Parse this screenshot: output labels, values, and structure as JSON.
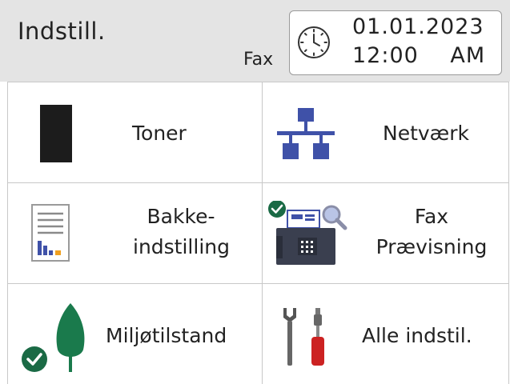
{
  "header": {
    "title": "Indstill.",
    "mode": "Fax",
    "date": "01.01.2023",
    "time": "12:00 AM"
  },
  "tiles": [
    {
      "label": "Toner",
      "icon": "toner-icon"
    },
    {
      "label": "Netværk",
      "icon": "network-icon"
    },
    {
      "label_line1": "Bakke-",
      "label_line2": "indstilling",
      "icon": "tray-settings-icon"
    },
    {
      "label_line1": "Fax",
      "label_line2": "Prævisning",
      "icon": "fax-preview-icon"
    },
    {
      "label": "Miljøtilstand",
      "icon": "eco-leaf-icon"
    },
    {
      "label": "Alle indstil.",
      "icon": "tools-icon"
    }
  ],
  "colors": {
    "header_bg": "#e4e4e4",
    "accent_blue": "#3f51a8",
    "eco_green": "#1a7a4c",
    "check_green": "#1a6a45",
    "tool_red": "#cc2222",
    "toner_black": "#1c1c1c"
  }
}
